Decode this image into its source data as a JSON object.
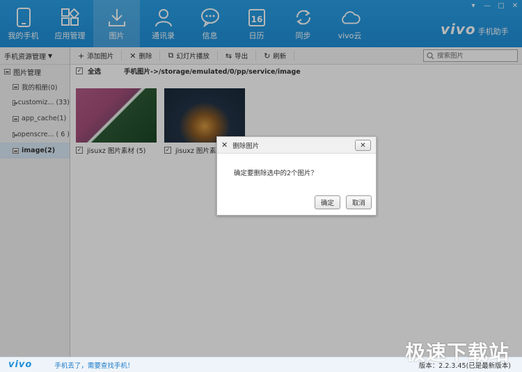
{
  "nav": {
    "items": [
      {
        "label": "我的手机",
        "icon": "phone-icon"
      },
      {
        "label": "应用管理",
        "icon": "apps-grid-icon"
      },
      {
        "label": "图片",
        "icon": "download-arrow-icon"
      },
      {
        "label": "通讯录",
        "icon": "contacts-person-icon"
      },
      {
        "label": "信息",
        "icon": "message-bubble-icon"
      },
      {
        "label": "日历",
        "icon": "calendar-icon",
        "icon_text": "16"
      },
      {
        "label": "同步",
        "icon": "sync-icon"
      },
      {
        "label": "vivo云",
        "icon": "cloud-icon"
      }
    ],
    "active_index": 2
  },
  "brand": {
    "logo": "vivo",
    "name": "手机助手"
  },
  "window_controls": [
    "▾",
    "—",
    "□",
    "✕"
  ],
  "sidebar": {
    "header": "手机资源管理",
    "category": "图片管理",
    "items": [
      {
        "label": "我的相册(0)"
      },
      {
        "label": "customiz... (33)"
      },
      {
        "label": "app_cache(1)"
      },
      {
        "label": "openscre... ( 6 )"
      },
      {
        "label": "image(2)"
      }
    ],
    "selected_index": 4
  },
  "toolbar": {
    "add": "添加图片",
    "delete": "删除",
    "slideshow": "幻灯片播放",
    "export": "导出",
    "refresh": "刷新",
    "search_placeholder": "搜索图片"
  },
  "pathbar": {
    "select_all": "全选",
    "path": "手机图片->/storage/emulated/0/pp/service/image"
  },
  "thumbnails": [
    {
      "caption": "jisuxz 图片素材 (5)",
      "checked": true
    },
    {
      "caption": "jisuxz 图片素材",
      "checked": true
    }
  ],
  "dialog": {
    "title": "删除图片",
    "message": "确定要删除选中的2个图片？",
    "ok": "确定",
    "cancel": "取消"
  },
  "footer": {
    "logo": "vivo",
    "link": "手机丢了，需要查找手机！",
    "version": "版本：2.2.3.45(已是最新版本)"
  },
  "watermark": "极速下载站",
  "colors": {
    "accent": "#1f8fd8",
    "selected": "#d9e9f7"
  }
}
